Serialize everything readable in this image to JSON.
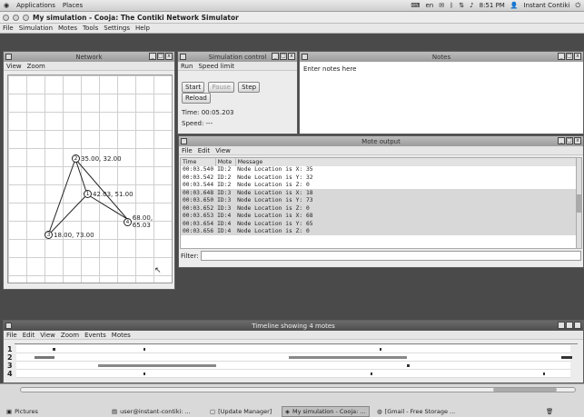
{
  "topbar": {
    "menus": [
      "Applications",
      "Places"
    ],
    "lang": "en",
    "clock": "8:51 PM",
    "user": "Instant Contiki"
  },
  "app": {
    "title": "My simulation - Cooja: The Contiki Network Simulator",
    "menus": [
      "File",
      "Simulation",
      "Motes",
      "Tools",
      "Settings",
      "Help"
    ]
  },
  "network": {
    "title": "Network",
    "menus": [
      "View",
      "Zoom"
    ],
    "nodes": [
      {
        "id": "2",
        "label": "2 35.00, 32.00"
      },
      {
        "id": "1",
        "label": "1 42.03, 51.00"
      },
      {
        "id": "4",
        "label": "4 68.00, 65.03"
      },
      {
        "id": "3",
        "label": "3 18.00, 73.00"
      }
    ]
  },
  "simcontrol": {
    "title": "Simulation control",
    "menus": [
      "Run",
      "Speed limit"
    ],
    "start": "Start",
    "pause": "Pause",
    "step": "Step",
    "reload": "Reload",
    "time": "Time: 00:05.203",
    "speed": "Speed: ---"
  },
  "notes": {
    "title": "Notes",
    "placeholder": "Enter notes here"
  },
  "moteoutput": {
    "title": "Mote output",
    "menus": [
      "File",
      "Edit",
      "View"
    ],
    "headers": [
      "Time",
      "Mote",
      "Message"
    ],
    "rows": [
      [
        "00:03.540",
        "ID:2",
        "Node Location is X: 35"
      ],
      [
        "00:03.542",
        "ID:2",
        "Node Location is Y: 32"
      ],
      [
        "00:03.544",
        "ID:2",
        "Node Location is Z: 0"
      ],
      [
        "00:03.648",
        "ID:3",
        "Node Location is X: 18"
      ],
      [
        "00:03.650",
        "ID:3",
        "Node Location is Y: 73"
      ],
      [
        "00:03.652",
        "ID:3",
        "Node Location is Z: 0"
      ],
      [
        "00:03.653",
        "ID:4",
        "Node Location is X: 68"
      ],
      [
        "00:03.654",
        "ID:4",
        "Node Location is Y: 65"
      ],
      [
        "00:03.656",
        "ID:4",
        "Node Location is Z: 0"
      ]
    ],
    "filter_label": "Filter:"
  },
  "timeline": {
    "title": "Timeline showing 4 motes",
    "menus": [
      "File",
      "Edit",
      "View",
      "Zoom",
      "Events",
      "Motes"
    ],
    "rows": [
      "1",
      "2",
      "3",
      "4"
    ]
  },
  "taskbar": {
    "items": [
      "Pictures",
      "user@instant-contiki: ...",
      "[Update Manager]",
      "My simulation - Cooja: ...",
      "[Gmail - Free Storage ..."
    ]
  }
}
